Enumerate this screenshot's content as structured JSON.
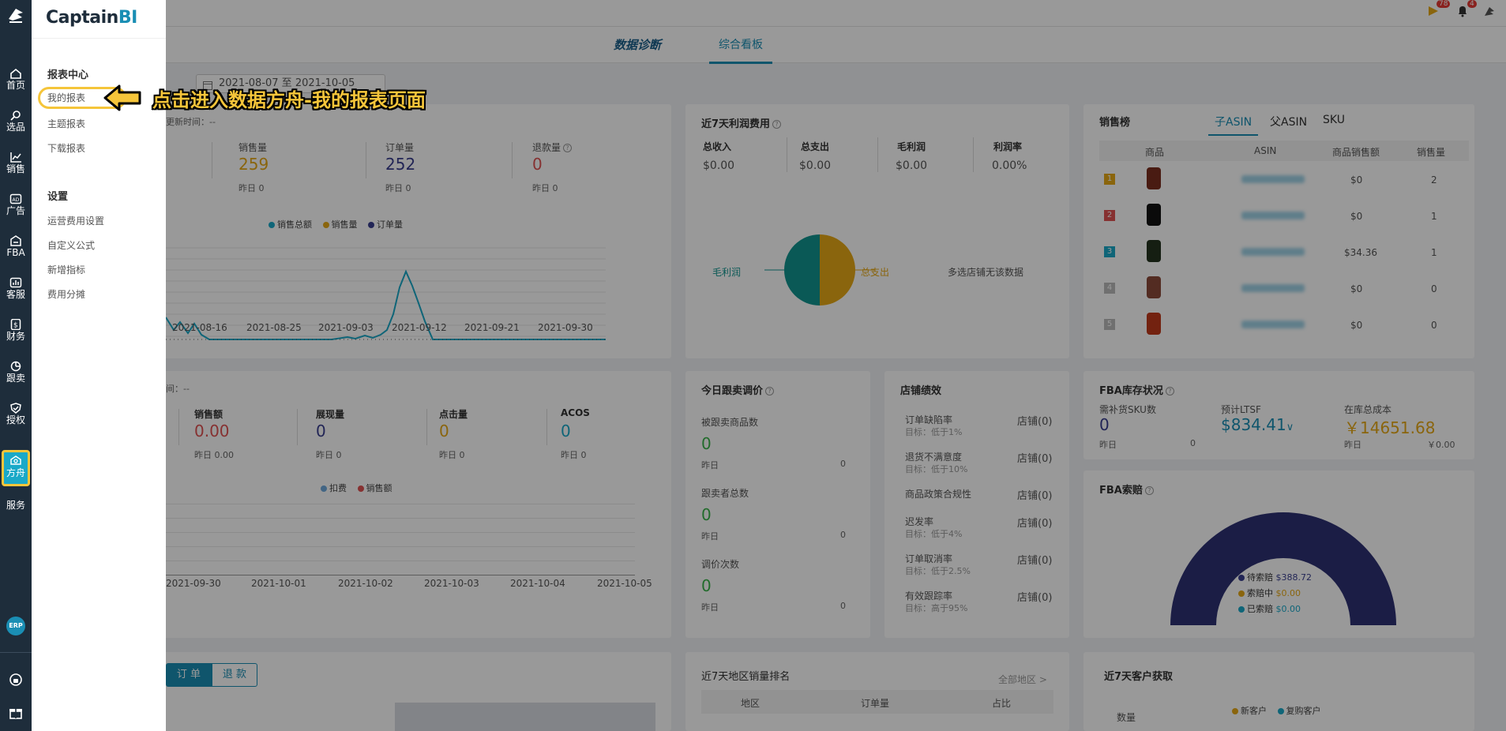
{
  "brand": {
    "name_main": "Captain",
    "name_accent": "BI"
  },
  "rail": {
    "items": [
      {
        "label": "首页",
        "icon": "home-icon"
      },
      {
        "label": "选品",
        "icon": "search-icon"
      },
      {
        "label": "销售",
        "icon": "line-chart-icon"
      },
      {
        "label": "广告",
        "icon": "ad-icon"
      },
      {
        "label": "FBA",
        "icon": "warehouse-icon"
      },
      {
        "label": "客服",
        "icon": "bar-chart-icon"
      },
      {
        "label": "财务",
        "icon": "dollar-icon"
      },
      {
        "label": "跟卖",
        "icon": "pie-icon"
      },
      {
        "label": "授权",
        "icon": "shield-check-icon"
      },
      {
        "label": "方舟",
        "icon": "ark-icon"
      },
      {
        "label": "服务",
        "icon": "service-icon"
      }
    ],
    "erp": "ERP"
  },
  "drawer": {
    "report_center": "报表中心",
    "report_items": [
      "我的报表",
      "主题报表",
      "下载报表"
    ],
    "settings": "设置",
    "settings_items": [
      "运营费用设置",
      "自定义公式",
      "新增指标",
      "费用分摊"
    ]
  },
  "callout": {
    "text": "点击进入数据方舟-我的报表页面"
  },
  "header": {
    "notify_count": "78",
    "bell_count": "4"
  },
  "tabs": {
    "diagnosis": "数据诊断",
    "dashboard": "综合看板"
  },
  "date_range": "2021-08-07 至 2021-10-05",
  "sales_card": {
    "update_time": "更新时间：--",
    "metrics": [
      {
        "label": "销售量",
        "value": "259",
        "sub": "昨日 0"
      },
      {
        "label": "订单量",
        "value": "252",
        "sub": "昨日 0"
      },
      {
        "label": "退款量",
        "value": "0",
        "sub": "昨日 0"
      }
    ],
    "legend": [
      "销售总额",
      "销售量",
      "订单量"
    ],
    "xticks": [
      "2021-08-16",
      "2021-08-25",
      "2021-09-03",
      "2021-09-12",
      "2021-09-21",
      "2021-09-30"
    ]
  },
  "profit_card": {
    "title": "近7天利润费用",
    "metrics": [
      {
        "label": "总收入",
        "value": "$0.00"
      },
      {
        "label": "总支出",
        "value": "$0.00"
      },
      {
        "label": "毛利润",
        "value": "$0.00"
      },
      {
        "label": "利润率",
        "value": "0.00%"
      }
    ],
    "pie_left": "毛利润",
    "pie_right": "总支出",
    "no_data": "多选店铺无该数据"
  },
  "rank_card": {
    "title": "销售榜",
    "tabs": [
      "子ASIN",
      "父ASIN",
      "SKU"
    ],
    "columns": [
      "商品",
      "ASIN",
      "商品销售额",
      "销售量"
    ],
    "rows": [
      {
        "rank": "1",
        "sales": "$0",
        "qty": "2"
      },
      {
        "rank": "2",
        "sales": "$0",
        "qty": "1"
      },
      {
        "rank": "3",
        "sales": "$34.36",
        "qty": "1"
      },
      {
        "rank": "4",
        "sales": "$0",
        "qty": "0"
      },
      {
        "rank": "5",
        "sales": "$0",
        "qty": "0"
      }
    ]
  },
  "ads_card": {
    "update_time": "间：--",
    "metrics": [
      {
        "label": "销售额",
        "value": "0.00",
        "sub": "昨日 0.00"
      },
      {
        "label": "展现量",
        "value": "0",
        "sub": "昨日 0"
      },
      {
        "label": "点击量",
        "value": "0",
        "sub": "昨日 0"
      },
      {
        "label": "ACOS",
        "value": "0",
        "sub": "昨日 0"
      }
    ],
    "legend": [
      "扣费",
      "销售额"
    ],
    "xticks": [
      "2021-09-30",
      "2021-10-01",
      "2021-10-02",
      "2021-10-03",
      "2021-10-04",
      "2021-10-05"
    ]
  },
  "follow_card": {
    "title": "今日跟卖调价",
    "blocks": [
      {
        "label": "被跟卖商品数",
        "value": "0",
        "yesterday": "昨日",
        "yval": "0"
      },
      {
        "label": "跟卖者总数",
        "value": "0",
        "yesterday": "昨日",
        "yval": "0"
      },
      {
        "label": "调价次数",
        "value": "0",
        "yesterday": "昨日",
        "yval": "0"
      }
    ]
  },
  "store_card": {
    "title": "店铺绩效",
    "rows": [
      {
        "label": "订单缺陷率",
        "target": "目标：低于1%",
        "status": "店铺(0)"
      },
      {
        "label": "退货不满意度",
        "target": "目标：低于10%",
        "status": "店铺(0)"
      },
      {
        "label": "商品政策合规性",
        "target": "",
        "status": "店铺(0)"
      },
      {
        "label": "迟发率",
        "target": "目标：低于4%",
        "status": "店铺(0)"
      },
      {
        "label": "订单取消率",
        "target": "目标：低于2.5%",
        "status": "店铺(0)"
      },
      {
        "label": "有效跟踪率",
        "target": "目标：高于95%",
        "status": "店铺(0)"
      }
    ]
  },
  "fba_card": {
    "title": "FBA库存状况",
    "metrics": [
      {
        "label": "需补货SKU数",
        "value": "0",
        "sub": "昨日",
        "subval": "0"
      },
      {
        "label": "预计LTSF",
        "value": "$834.41",
        "sub": "",
        "subval": ""
      },
      {
        "label": "在库总成本",
        "value": "￥14651.68",
        "sub": "昨日",
        "subval": "￥0.00"
      }
    ]
  },
  "claim_card": {
    "title": "FBA索赔",
    "legend": [
      {
        "label": "待索赔",
        "value": "$388.72"
      },
      {
        "label": "索赔中",
        "value": "$0.00"
      },
      {
        "label": "已索赔",
        "value": "$0.00"
      }
    ]
  },
  "bottom": {
    "toggle": [
      "订 单",
      "退 款"
    ],
    "region_title": "近7天地区销量排名",
    "region_link": "全部地区 >",
    "region_cols": [
      "地区",
      "订单量",
      "占比"
    ],
    "customer_title": "近7天客户获取",
    "customer_legend": [
      "新客户",
      "复购客户"
    ],
    "customer_axis": "数量"
  },
  "colors": {
    "accent": "#1a8eb4",
    "rail": "#1e2d3b",
    "highlight": "#f5c53a",
    "orange": "#e6a817",
    "purple": "#3a3f8f",
    "red": "#e05252",
    "green": "#39b54a",
    "teal": "#12958f"
  }
}
